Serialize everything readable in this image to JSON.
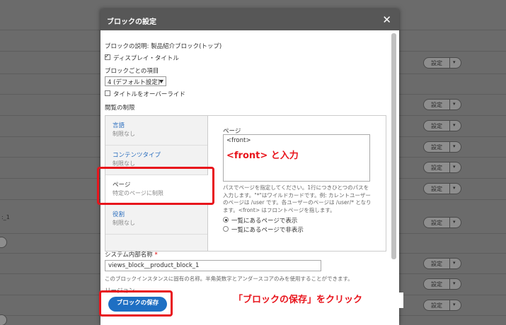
{
  "background": {
    "button_label": "設定",
    "button_arrow": "▾",
    "left_text": ":_1"
  },
  "dialog": {
    "title": "ブロックの設定",
    "close_icon": "✕",
    "description_label": "ブロックの説明: 製品紹介ブロック(トップ)",
    "display_title_label": "ディスプレイ・タイトル",
    "items_per_block_label": "ブロックごとの項目",
    "items_per_block_value": "4 (デフォルト設定)",
    "override_title_label": "タイトルをオーバーライド",
    "visibility_label": "閲覧の制限",
    "vertical_tabs": [
      {
        "title": "言語",
        "summary": "制限なし"
      },
      {
        "title": "コンテンツタイプ",
        "summary": "制限なし"
      },
      {
        "title": "ページ",
        "summary": "特定のページに制限"
      },
      {
        "title": "役割",
        "summary": "制限なし"
      }
    ],
    "pages": {
      "label": "ページ",
      "value": "<front>",
      "help": "パスでページを指定してください。1行につきひとつのパスを入力します。\"*\"はワイルドカードです。例: カレントユーザーのページは /user です。各ユーザーのページは /user/* となります。<front> はフロントページを指します。",
      "radio_show": "一覧にあるページで表示",
      "radio_hide": "一覧にあるページで非表示"
    },
    "machine_name_label": "システム内部名称",
    "machine_name_required": "*",
    "machine_name_value": "views_block__product_block_1",
    "machine_name_help": "このブロックインスタンスに固有の名称。半角英数字とアンダースコアのみを使用することができます。",
    "region_label_partial": "リージョン",
    "save_button": "ブロックの保存"
  },
  "annotations": {
    "front_hint": "<front> と入力",
    "save_hint": "「ブロックの保存」をクリック",
    "color": "#e8131b"
  }
}
